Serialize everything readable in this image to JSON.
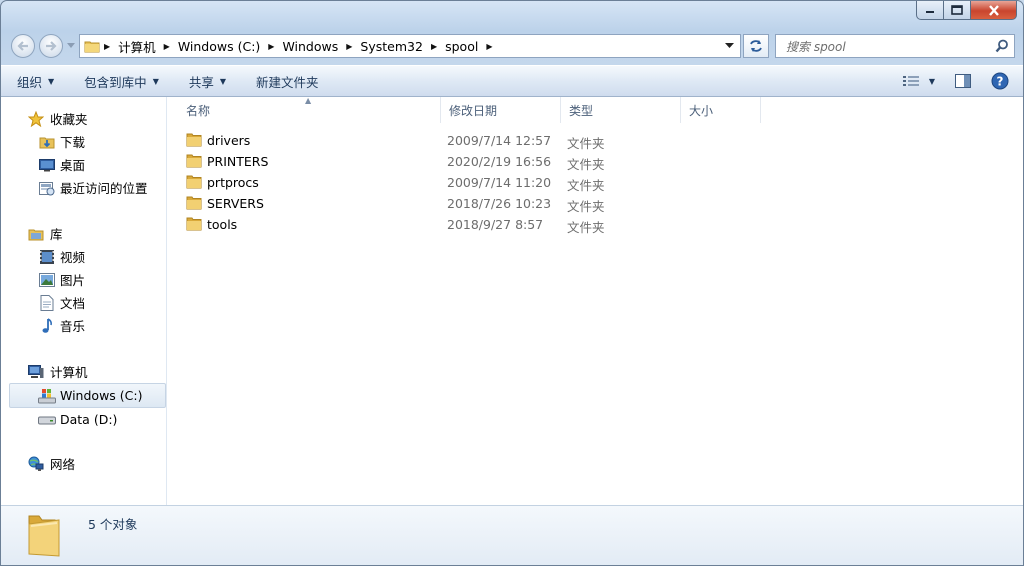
{
  "window": {
    "minimize_symbol": "▬",
    "maximize_symbol": "▣",
    "close_symbol": "✕"
  },
  "address": {
    "crumbs": [
      "计算机",
      "Windows (C:)",
      "Windows",
      "System32",
      "spool"
    ]
  },
  "search": {
    "placeholder": "搜索 spool"
  },
  "toolbar": {
    "organize": "组织",
    "include_in_library": "包含到库中",
    "share": "共享",
    "new_folder": "新建文件夹"
  },
  "sidebar": {
    "favorites": {
      "label": "收藏夹",
      "items": [
        "下载",
        "桌面",
        "最近访问的位置"
      ]
    },
    "libraries": {
      "label": "库",
      "items": [
        "视频",
        "图片",
        "文档",
        "音乐"
      ]
    },
    "computer": {
      "label": "计算机",
      "items": [
        "Windows (C:)",
        "Data (D:)"
      ]
    },
    "network": {
      "label": "网络"
    }
  },
  "columns": {
    "name": "名称",
    "date": "修改日期",
    "type": "类型",
    "size": "大小"
  },
  "files": [
    {
      "name": "drivers",
      "date": "2009/7/14 12:57",
      "type": "文件夹"
    },
    {
      "name": "PRINTERS",
      "date": "2020/2/19 16:56",
      "type": "文件夹"
    },
    {
      "name": "prtprocs",
      "date": "2009/7/14 11:20",
      "type": "文件夹"
    },
    {
      "name": "SERVERS",
      "date": "2018/7/26 10:23",
      "type": "文件夹"
    },
    {
      "name": "tools",
      "date": "2018/9/27 8:57",
      "type": "文件夹"
    }
  ],
  "details": {
    "count": "5 个对象"
  },
  "colors": {
    "accent": "#1e395b",
    "selection": "#dde8f3",
    "folder": "#e8c25a"
  }
}
